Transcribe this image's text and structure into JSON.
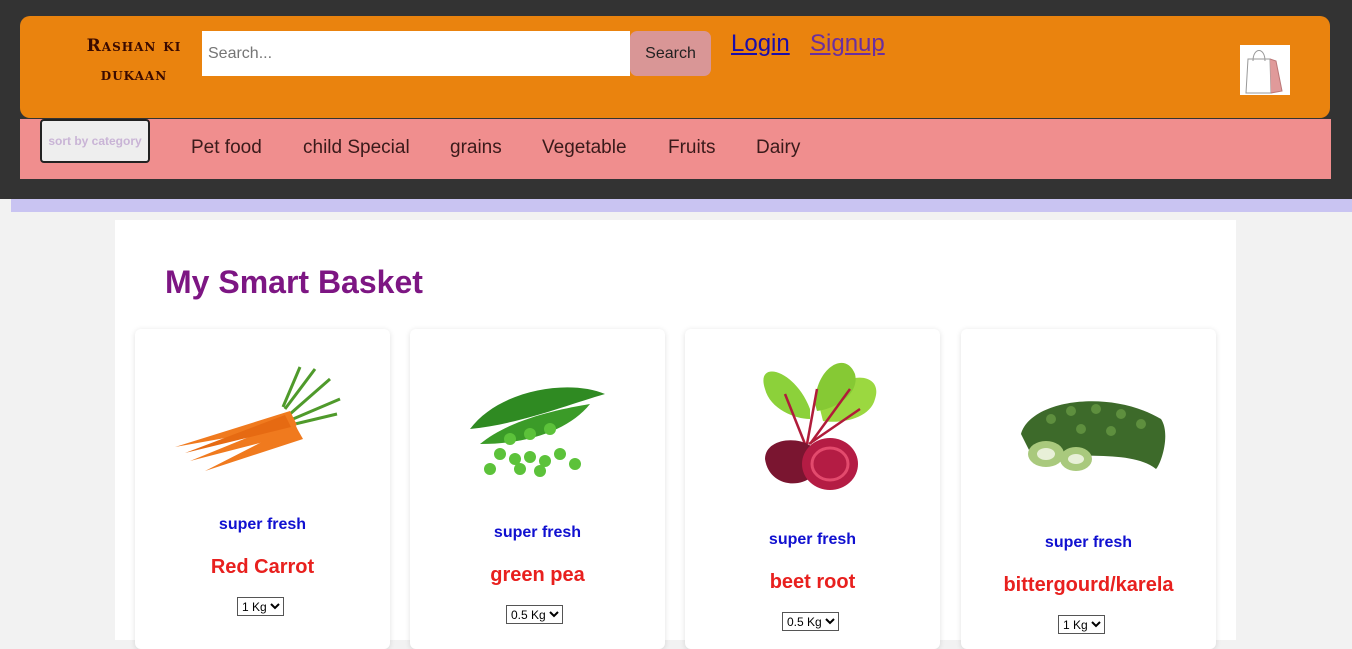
{
  "header": {
    "logo_line1": "Rashan ki",
    "logo_line2": "dukaan",
    "search_placeholder": "Search...",
    "search_button": "Search",
    "login": "Login",
    "signup": "Signup",
    "cart_icon": "shopping-bag-icon"
  },
  "categories": {
    "sort_label": "sort by category",
    "items": [
      "Pet food",
      "child Special",
      "grains",
      "Vegetable",
      "Fruits",
      "Dairy"
    ]
  },
  "main": {
    "title": "My Smart Basket",
    "products": [
      {
        "tag": "super fresh",
        "name": "Red Carrot",
        "qty": "1 Kg",
        "image": "carrot-image"
      },
      {
        "tag": "super fresh",
        "name": "green pea",
        "qty": "0.5 Kg",
        "image": "green-pea-image"
      },
      {
        "tag": "super fresh",
        "name": "beet root",
        "qty": "0.5 Kg",
        "image": "beetroot-image"
      },
      {
        "tag": "super fresh",
        "name": "bittergourd/karela",
        "qty": "1 Kg",
        "image": "bittergourd-image"
      }
    ]
  },
  "colors": {
    "header_bg": "#ea830e",
    "topbar_bg": "#333333",
    "category_bar_bg": "#f08e8e",
    "title": "#7d1683",
    "tag": "#1010d0",
    "product_name": "#e8201e"
  }
}
